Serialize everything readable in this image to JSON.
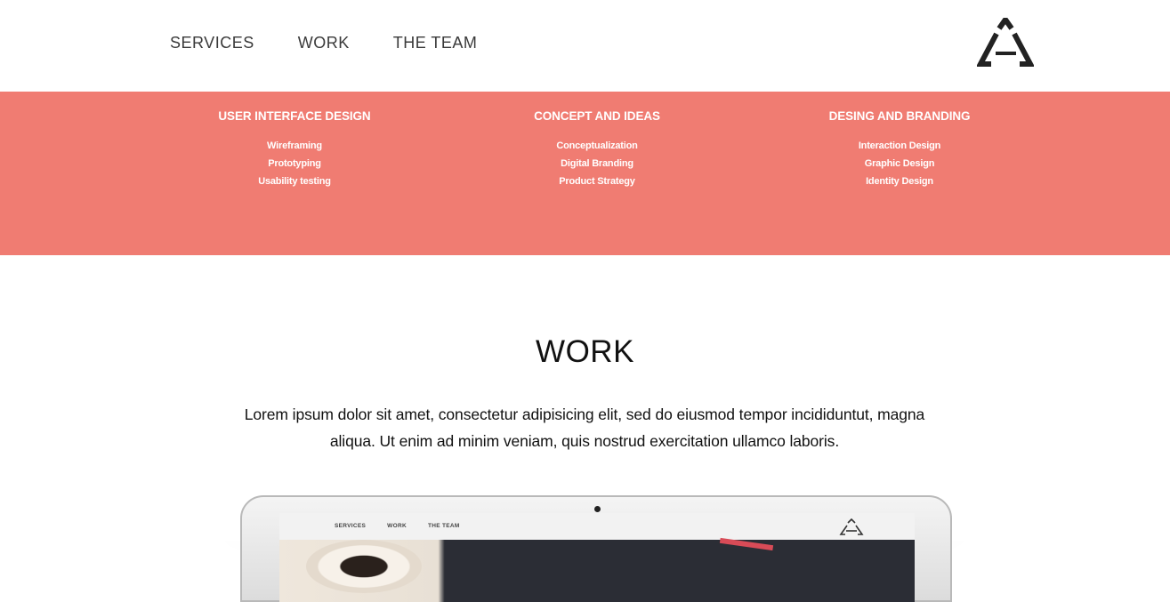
{
  "header": {
    "nav": [
      "SERVICES",
      "WORK",
      "THE TEAM"
    ],
    "logo_icon": "triangle-logo-icon"
  },
  "services": {
    "background_color": "#f07c72",
    "columns": [
      {
        "title": "USER INTERFACE DESIGN",
        "items": [
          "Wireframing",
          "Prototyping",
          "Usability testing"
        ]
      },
      {
        "title": "CONCEPT AND IDEAS",
        "items": [
          "Conceptualization",
          "Digital Branding",
          "Product Strategy"
        ]
      },
      {
        "title": "DESING AND BRANDING",
        "items": [
          "Interaction Design",
          "Graphic Design",
          "Identity Design"
        ]
      }
    ]
  },
  "work": {
    "title": "WORK",
    "text": "Lorem ipsum dolor sit amet, consectetur adipisicing elit, sed do eiusmod tempor incididuntut, magna aliqua. Ut enim ad minim veniam, quis nostrud exercitation ullamco laboris."
  },
  "mockup": {
    "nav": [
      "SERVICES",
      "WORK",
      "THE TEAM"
    ]
  }
}
